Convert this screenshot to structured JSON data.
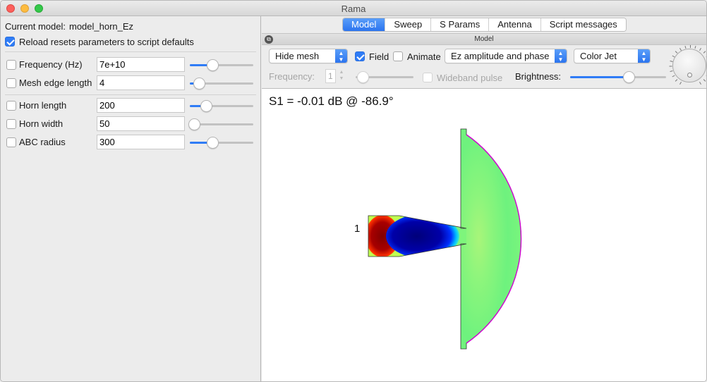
{
  "window": {
    "title": "Rama"
  },
  "left_panel": {
    "current_model_label": "Current model:",
    "current_model_value": "model_horn_Ez",
    "reload_label": "Reload resets parameters to script defaults",
    "reload_checked": true,
    "params": [
      {
        "label": "Frequency (Hz)",
        "value": "7e+10",
        "slider_fraction": 0.35
      },
      {
        "label": "Mesh edge length",
        "value": "4",
        "slider_fraction": 0.14
      },
      {
        "label": "Horn length",
        "value": "200",
        "slider_fraction": 0.25
      },
      {
        "label": "Horn width",
        "value": "50",
        "slider_fraction": 0.07
      },
      {
        "label": "ABC radius",
        "value": "300",
        "slider_fraction": 0.35
      }
    ]
  },
  "tabs": [
    {
      "label": "Model",
      "active": true
    },
    {
      "label": "Sweep",
      "active": false
    },
    {
      "label": "S Params",
      "active": false
    },
    {
      "label": "Antenna",
      "active": false
    },
    {
      "label": "Script messages",
      "active": false
    }
  ],
  "dock": {
    "title": "Model"
  },
  "toolbar": {
    "mesh_select": "Hide mesh",
    "field_label": "Field",
    "field_checked": true,
    "animate_label": "Animate",
    "animate_checked": false,
    "display_select": "Ez amplitude and phase",
    "colormap_select": "Color Jet",
    "frequency_label": "Frequency:",
    "frequency_value": "1",
    "wideband_label": "Wideband pulse",
    "brightness_label": "Brightness:",
    "brightness_fraction": 0.61
  },
  "view": {
    "s1_text": "S1 = -0.01 dB @ -86.9°",
    "port_label": "1"
  },
  "colors": {
    "accent": "#2f7cf6",
    "field_green": "#7ef57c",
    "boundary_magenta": "#d000d0",
    "field_darkred": "#8b0000",
    "field_darkblue": "#00008b"
  }
}
